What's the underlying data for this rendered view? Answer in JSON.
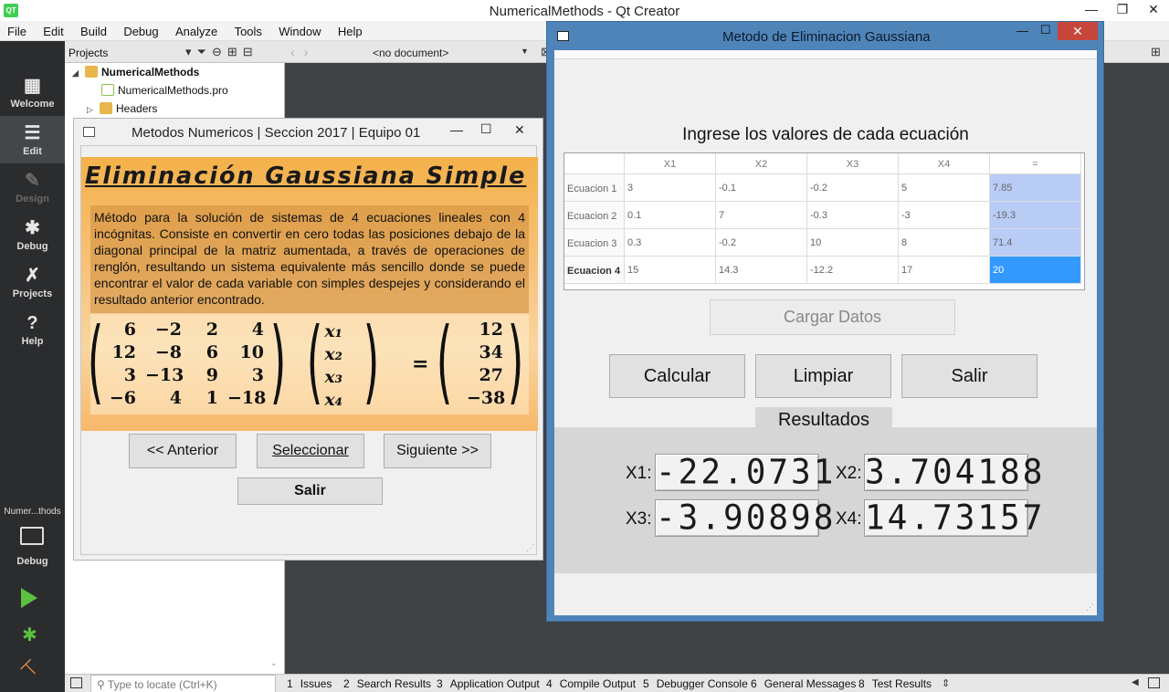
{
  "qt_creator": {
    "window_title": "NumericalMethods - Qt Creator",
    "logo_text": "QT",
    "menu": [
      "File",
      "Edit",
      "Build",
      "Debug",
      "Analyze",
      "Tools",
      "Window",
      "Help"
    ],
    "modes": [
      {
        "label": "Welcome",
        "icon": "grid-icon"
      },
      {
        "label": "Edit",
        "icon": "edit-icon"
      },
      {
        "label": "Design",
        "icon": "pen-icon"
      },
      {
        "label": "Debug",
        "icon": "bug-icon"
      },
      {
        "label": "Projects",
        "icon": "wrench-icon"
      },
      {
        "label": "Help",
        "icon": "help-icon"
      }
    ],
    "target_selector": {
      "project": "Numer...thods",
      "config": "Debug"
    },
    "projects_pane": {
      "title": "Projects",
      "tree": [
        {
          "label": "NumericalMethods",
          "expanded": true
        },
        {
          "label": "NumericalMethods.pro"
        },
        {
          "label": "Headers",
          "expanded": false
        }
      ]
    },
    "editor": {
      "document": "<no document>"
    },
    "locator_placeholder": "Type to locate (Ctrl+K)",
    "output_panes": [
      {
        "num": "1",
        "label": "Issues"
      },
      {
        "num": "2",
        "label": "Search Results"
      },
      {
        "num": "3",
        "label": "Application Output"
      },
      {
        "num": "4",
        "label": "Compile Output"
      },
      {
        "num": "5",
        "label": "Debugger Console"
      },
      {
        "num": "6",
        "label": "General Messages"
      },
      {
        "num": "8",
        "label": "Test Results"
      }
    ]
  },
  "mn_window": {
    "title": "Metodos Numericos | Seccion 2017 | Equipo 01",
    "heading": "Eliminación Gaussiana Simple",
    "description": "Método para la solución de sistemas de 4 ecuaciones lineales con 4 incógnitas. Consiste en convertir en cero todas las posiciones debajo de la diagonal principal de la matriz aumentada, a través de operaciones de renglón, resultando un sistema equivalente más sencillo donde se puede encontrar el valor de cada variable con simples despejes y considerando el resultado anterior encontrado.",
    "matrix": [
      [
        "6",
        "−2",
        "2",
        "4"
      ],
      [
        "12",
        "−8",
        "6",
        "10"
      ],
      [
        "3",
        "−13",
        "9",
        "3"
      ],
      [
        "−6",
        "4",
        "1",
        "−18"
      ]
    ],
    "vars": [
      "x₁",
      "x₂",
      "x₃",
      "x₄"
    ],
    "equals": "=",
    "rhs": [
      "12",
      "34",
      "27",
      "−38"
    ],
    "buttons": {
      "prev": "<< Anterior",
      "select": "Seleccionar",
      "next": "Siguiente >>",
      "exit": "Salir"
    }
  },
  "eg_window": {
    "title": "Metodo de Eliminacion Gaussiana",
    "heading": "Ingrese los valores de cada ecuación",
    "columns": [
      "X1",
      "X2",
      "X3",
      "X4",
      "="
    ],
    "rows": [
      {
        "label": "Ecuacion 1",
        "values": [
          "3",
          "-0.1",
          "-0.2",
          "5",
          "7.85"
        ]
      },
      {
        "label": "Ecuacion 2",
        "values": [
          "0.1",
          "7",
          "-0.3",
          "-3",
          "-19.3"
        ]
      },
      {
        "label": "Ecuacion 3",
        "values": [
          "0.3",
          "-0.2",
          "10",
          "8",
          "71.4"
        ]
      },
      {
        "label": "Ecuacion 4",
        "values": [
          "15",
          "14.3",
          "-12.2",
          "17",
          "20"
        ]
      }
    ],
    "buttons": {
      "load": "Cargar Datos",
      "calc": "Calcular",
      "clear": "Limpiar",
      "exit": "Salir"
    },
    "results_title": "Resultados",
    "results": [
      {
        "label": "X1:",
        "value": "-22.0731"
      },
      {
        "label": "X2:",
        "value": "3.704188"
      },
      {
        "label": "X3:",
        "value": "-3.90898"
      },
      {
        "label": "X4:",
        "value": "14.73157"
      }
    ],
    "colors": {
      "rhs_column": "#b9ccf6",
      "selected_cell": "#3399ff",
      "close_button": "#c7453b",
      "frame": "#4f84b8"
    }
  }
}
